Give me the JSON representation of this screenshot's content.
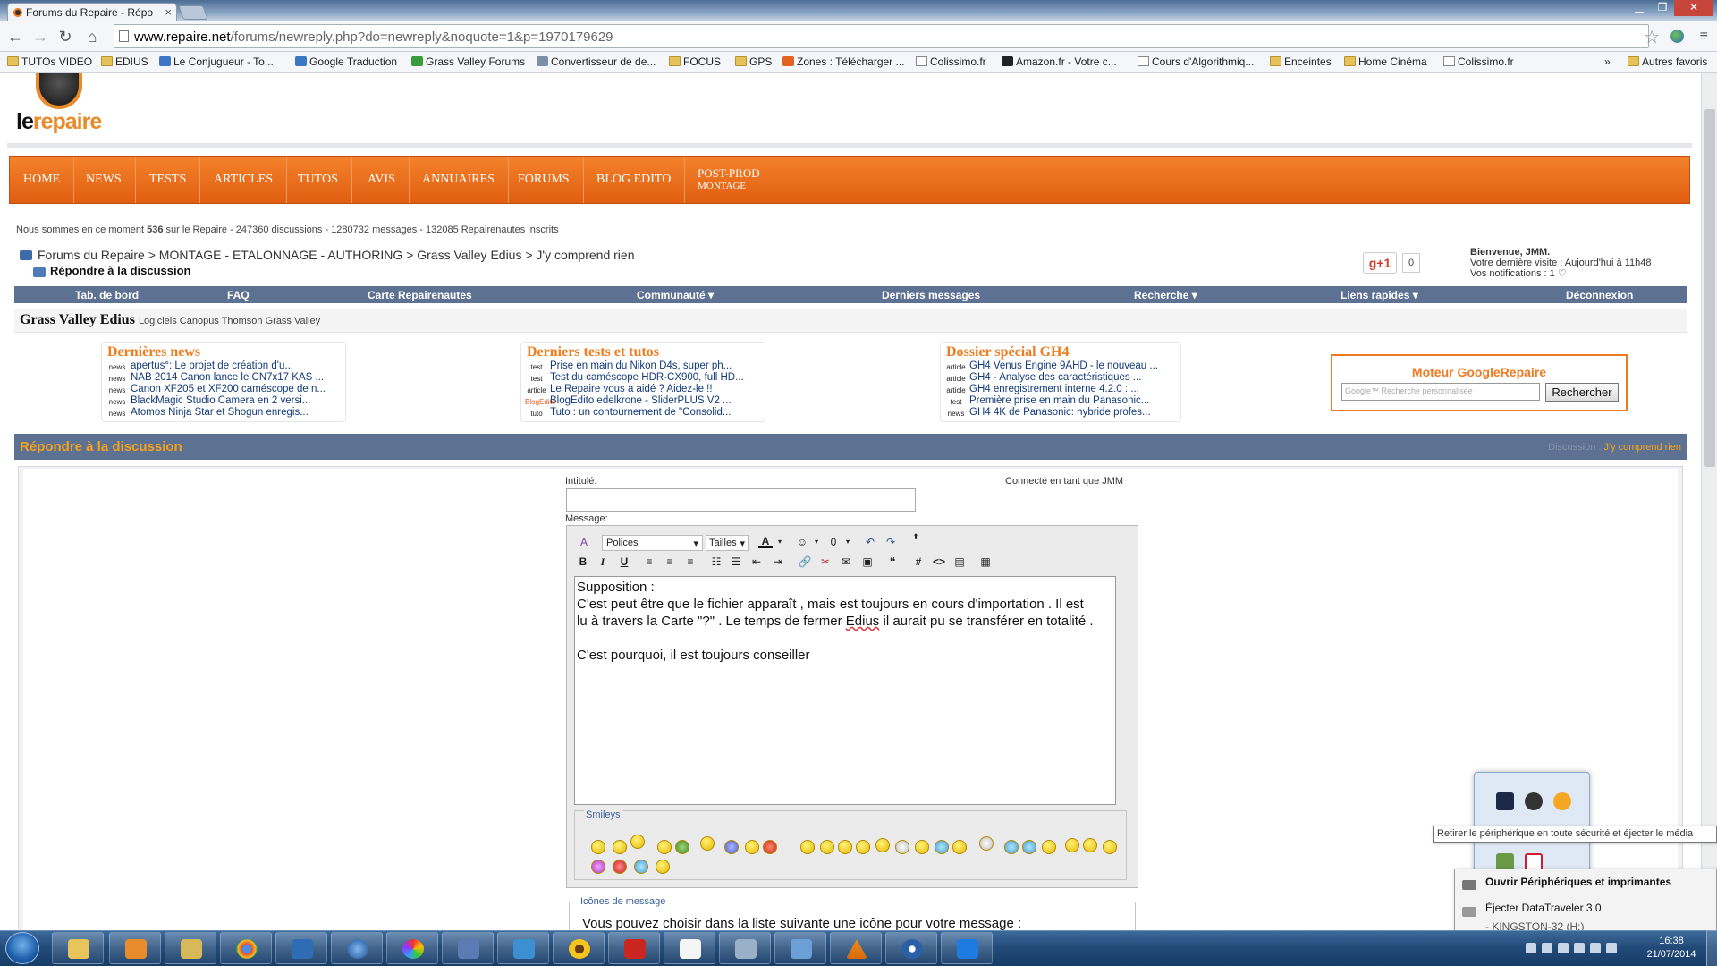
{
  "browser": {
    "tab_title": "Forums du Repaire - Répo",
    "url_host": "www.repaire.net",
    "url_path": "/forums/newreply.php?do=newreply&noquote=1&p=1970179629",
    "bookmarks": [
      {
        "label": "TUTOs VIDEO",
        "type": "folder"
      },
      {
        "label": "EDIUS",
        "type": "folder"
      },
      {
        "label": "Le Conjugueur - To...",
        "type": "site"
      },
      {
        "label": "Google Traduction",
        "type": "site"
      },
      {
        "label": "Grass Valley Forums",
        "type": "site"
      },
      {
        "label": "Convertisseur de de...",
        "type": "site"
      },
      {
        "label": "FOCUS",
        "type": "folder"
      },
      {
        "label": "GPS",
        "type": "folder"
      },
      {
        "label": "Zones : Télécharger ...",
        "type": "site"
      },
      {
        "label": "Colissimo.fr",
        "type": "page"
      },
      {
        "label": "Amazon.fr - Votre c...",
        "type": "site"
      },
      {
        "label": "Cours d'Algorithmiq...",
        "type": "page"
      },
      {
        "label": "Enceintes",
        "type": "folder"
      },
      {
        "label": "Home Cinéma",
        "type": "folder"
      },
      {
        "label": "Colissimo.fr",
        "type": "page"
      }
    ],
    "bookmarks_more": "»",
    "other_bookmarks": "Autres favoris"
  },
  "site": {
    "logo_le": "le",
    "logo_repaire": "repaire",
    "nav": [
      "HOME",
      "NEWS",
      "TESTS",
      "ARTICLES",
      "TUTOS",
      "AVIS",
      "ANNUAIRES",
      "FORUMS",
      "BLOG EDITO"
    ],
    "nav_last_line1": "POST-PROD",
    "nav_last_line2": "MONTAGE",
    "stats_pre": "Nous sommes en ce moment ",
    "stats_bold": "536",
    "stats_post": " sur le Repaire - 247360 discussions - 1280732 messages - 132085 Repairenautes inscrits",
    "breadcrumb": "Forums du Repaire > MONTAGE - ETALONNAGE - AUTHORING > Grass Valley Edius > J'y comprend rien",
    "breadcrumb_current": "Répondre à la discussion",
    "gplus": "g+1",
    "gplus_count": "0",
    "welcome_line1": "Bienvenue, JMM.",
    "welcome_line2": "Votre dernière visite : Aujourd'hui à 11h48",
    "welcome_line3": "Vos notifications : 1 ♡",
    "userbar": [
      "Tab. de bord",
      "FAQ",
      "Carte Repairenautes",
      "Communauté ▾",
      "Derniers messages",
      "Recherche ▾",
      "Liens rapides ▾",
      "Déconnexion"
    ],
    "forum_title": "Grass Valley Edius",
    "forum_desc": "Logiciels Canopus Thomson Grass Valley"
  },
  "blocks": [
    {
      "title": "Dernières news",
      "items": [
        {
          "tag": "news",
          "text": "apertus°: Le projet de création d'u..."
        },
        {
          "tag": "news",
          "text": "NAB 2014 Canon lance le CN7x17 KAS ..."
        },
        {
          "tag": "news",
          "text": "Canon XF205 et XF200 caméscope de n..."
        },
        {
          "tag": "news",
          "text": "BlackMagic Studio Camera en 2 versi..."
        },
        {
          "tag": "news",
          "text": "Atomos Ninja Star et Shogun enregis..."
        }
      ]
    },
    {
      "title": "Derniers tests et tutos",
      "items": [
        {
          "tag": "test",
          "text": "Prise en main du Nikon D4s, super ph..."
        },
        {
          "tag": "test",
          "text": "Test du caméscope HDR-CX900, full HD..."
        },
        {
          "tag": "article",
          "text": "Le Repaire vous a aidé ? Aidez-le !!"
        },
        {
          "tag": "BlogEdito",
          "text": "BlogEdito edelkrone - SliderPLUS V2 ..."
        },
        {
          "tag": "tuto",
          "text": "Tuto : un contournement de \"Consolid..."
        }
      ]
    },
    {
      "title": "Dossier spécial GH4",
      "items": [
        {
          "tag": "article",
          "text": "GH4 Venus Engine 9AHD - le nouveau ..."
        },
        {
          "tag": "article",
          "text": "GH4 - Analyse des caractéristiques ..."
        },
        {
          "tag": "article",
          "text": "GH4 enregistrement interne 4.2.0 : ..."
        },
        {
          "tag": "test",
          "text": "Première prise en main du Panasonic..."
        },
        {
          "tag": "news",
          "text": "GH4 4K de Panasonic: hybride profes..."
        }
      ]
    }
  ],
  "google": {
    "title": "Moteur GoogleRepaire",
    "placeholder": "Google™ Recherche personnalisée",
    "button": "Rechercher"
  },
  "reply": {
    "bar_title": "Répondre à la discussion",
    "bar_right_label": "Discussion : ",
    "bar_right_link": "J'y comprend rien",
    "label_title": "Intitulé:",
    "connected": "Connecté en tant que JMM",
    "label_message": "Message:",
    "font_select": "Polices",
    "size_select": "Tailles",
    "message_lines": [
      "Supposition :",
      "C'est peut être que le fichier apparaît , mais  est  toujours en cours d'importation . Il est",
      "lu à travers la Carte \"?\"  . Le temps de fermer ",
      "",
      "C'est pourquoi, il est toujours conseiller"
    ],
    "msg_underlined": "Edius",
    "msg_line3_tail": " il aurait pu se transférer en totalité .",
    "smileys_legend": "Smileys",
    "icons_legend": "Icônes de message",
    "icons_text": "Vous pouvez choisir dans la liste suivante une icône pour votre message :"
  },
  "system": {
    "tooltip": "Retirer le périphérique en toute sécurité et éjecter le média",
    "menu_open": "Ouvrir Périphériques et imprimantes",
    "menu_eject": "Éjecter DataTraveler 3.0",
    "menu_drive": "-   KINGSTON-32 (H:)",
    "clock_time": "16:38",
    "clock_date": "21/07/2014"
  }
}
